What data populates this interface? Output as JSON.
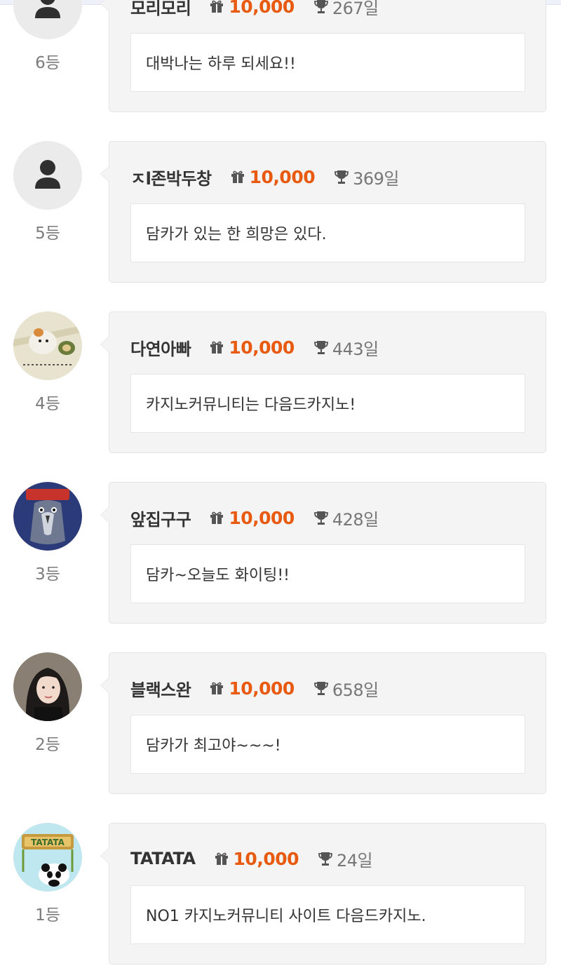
{
  "entries": [
    {
      "rank": "6등",
      "name": "모리모리",
      "points": "10,000",
      "days": "267일",
      "message": "대박나는 하루 되세요!!",
      "avatar": "person-icon"
    },
    {
      "rank": "5등",
      "name": "ㅈl존박두창",
      "points": "10,000",
      "days": "369일",
      "message": "담카가 있는 한 희망은 있다.",
      "avatar": "person-icon"
    },
    {
      "rank": "4등",
      "name": "다연아빠",
      "points": "10,000",
      "days": "443일",
      "message": "카지노커뮤니티는 다음드카지노!",
      "avatar": "hamster-photo"
    },
    {
      "rank": "3등",
      "name": "앞집구구",
      "points": "10,000",
      "days": "428일",
      "message": "담카~오늘도 화이팅!!",
      "avatar": "pigeon-photo"
    },
    {
      "rank": "2등",
      "name": "블랙스완",
      "points": "10,000",
      "days": "658일",
      "message": "담카가 최고야~~~!",
      "avatar": "woman-photo"
    },
    {
      "rank": "1등",
      "name": "TATATA",
      "points": "10,000",
      "days": "24일",
      "message": "NO1 카지노커뮤니티 사이트 다음드카지노.",
      "avatar": "tatata-panda-photo"
    }
  ],
  "colors": {
    "points": "#e85a0f",
    "bubble": "#f4f4f4",
    "rank": "#7b7b7b"
  }
}
